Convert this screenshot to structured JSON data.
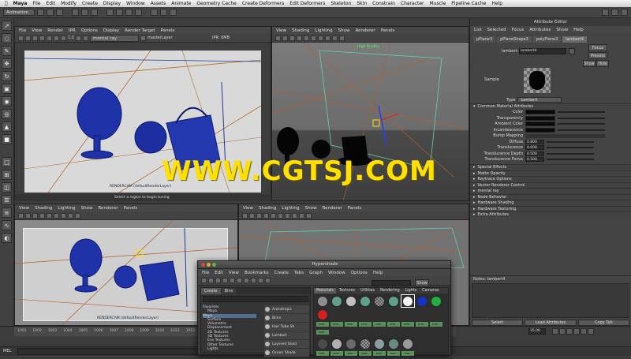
{
  "menubar": {
    "apple": "",
    "items": [
      "Maya",
      "File",
      "Edit",
      "Modify",
      "Create",
      "Display",
      "Window",
      "Assets",
      "Animate",
      "Geometry Cache",
      "Create Deformers",
      "Edit Deformers",
      "Skeleton",
      "Skin",
      "Constrain",
      "Character",
      "Muscle",
      "Pipeline Cache",
      "Help"
    ]
  },
  "shelf": {
    "menu_set": "Animation"
  },
  "viewport_tl": {
    "menu": [
      "View",
      "Shading",
      "Lighting",
      "Show",
      "Renderer",
      "Panels"
    ],
    "render_menu": [
      "File",
      "View",
      "Render",
      "IPR",
      "Options",
      "Display",
      "Render Target",
      "Panels"
    ],
    "ratio": "1:1",
    "renderer": "mental ray",
    "layer": "masterLayer",
    "ipr_size": "IPR: 0MB",
    "caption": "RENDERCAM (defaultRenderLayer)",
    "status": "Select a region to begin tuning"
  },
  "viewport_tr": {
    "menu": [
      "View",
      "Shading",
      "Lighting",
      "Show",
      "Renderer",
      "Panels"
    ],
    "quality_label": "High Quality"
  },
  "viewport_bl": {
    "menu": [
      "View",
      "Shading",
      "Lighting",
      "Show",
      "Renderer",
      "Panels"
    ],
    "caption": "RENDERCAM (defaultRenderLayer)"
  },
  "viewport_br": {
    "menu": [
      "View",
      "Shading",
      "Lighting",
      "Show",
      "Renderer",
      "Panels"
    ]
  },
  "attribute_editor": {
    "title": "Attribute Editor",
    "menu": [
      "List",
      "Selected",
      "Focus",
      "Attributes",
      "Show",
      "Help"
    ],
    "tabs": [
      "pPlane3",
      "pPlaneShape3",
      "polyPlane2",
      "lambert4"
    ],
    "node_label": "lambert:",
    "node_name": "lambert4",
    "focus": "Focus",
    "presets": "Presets",
    "show": "Show",
    "hide": "Hide",
    "sample_label": "Sample",
    "type_label": "Type",
    "type_value": "Lambert",
    "common_section": "Common Material Attributes",
    "attributes": [
      {
        "label": "Color",
        "kind": "swatch"
      },
      {
        "label": "Transparency",
        "kind": "swatch"
      },
      {
        "label": "Ambient Color",
        "kind": "swatch"
      },
      {
        "label": "Incandescence",
        "kind": "swatch"
      },
      {
        "label": "Bump Mapping",
        "kind": "bar"
      },
      {
        "label": "Diffuse",
        "kind": "value",
        "value": "0.800"
      },
      {
        "label": "Translucence",
        "kind": "value",
        "value": "0.000"
      },
      {
        "label": "Translucence Depth",
        "kind": "value",
        "value": "0.500"
      },
      {
        "label": "Translucence Focus",
        "kind": "value",
        "value": "0.500"
      }
    ],
    "sections": [
      "Special Effects",
      "Matte Opacity",
      "Raytrace Options",
      "Vector Renderer Control",
      "mental ray",
      "Node Behavior",
      "Hardware Shading",
      "Hardware Texturing",
      "Extra Attributes"
    ],
    "notes": "Notes:  lambert4",
    "select": "Select",
    "load_attributes": "Load Attributes",
    "copy_tab": "Copy Tab"
  },
  "hypershade": {
    "title": "Hypershade",
    "menu": [
      "File",
      "Edit",
      "View",
      "Bookmarks",
      "Create",
      "Tabs",
      "Graph",
      "Window",
      "Options",
      "Help"
    ],
    "show": "Show",
    "left_tabs": [
      "Create",
      "Bins"
    ],
    "tree": [
      "Favorites",
      "Maya",
      "Maya",
      "Surface",
      "Volumetric",
      "Displacement",
      "2D Textures",
      "3D Textures",
      "Env Textures",
      "Other Textures",
      "Lights"
    ],
    "list": [
      "Anisotropic",
      "Blinn",
      "Hair Tube Sh",
      "Lambert",
      "Layered Shad",
      "Ocean Shade"
    ],
    "tabs": [
      "Materials",
      "Textures",
      "Utilities",
      "Rendering",
      "Lights",
      "Cameras"
    ],
    "row1_labels": [
      "lam..",
      "lam..",
      "lam..",
      "lam..",
      "lam..",
      "lam..",
      "lam..",
      "lam..",
      "lam..",
      "lam.."
    ],
    "row2_labels": [
      "mia..",
      "mia..",
      "par..",
      "pho..",
      "sha..",
      "sur..",
      "lot.."
    ]
  },
  "timeline": {
    "ticks": [
      "1001",
      "1002",
      "1003",
      "1004",
      "1005",
      "1006",
      "1007",
      "1008",
      "1009",
      "1010",
      "1011",
      "1012",
      "1013",
      "1014",
      "1015",
      "1016",
      "1017",
      "1018",
      "1019",
      "1020",
      "1021",
      "1022",
      "1023",
      "1024",
      "1025",
      "1026",
      "1027",
      "1028"
    ],
    "current_frame": "35.00",
    "mel": "MEL"
  },
  "watermark": "WWW.CGTSJ.COM"
}
